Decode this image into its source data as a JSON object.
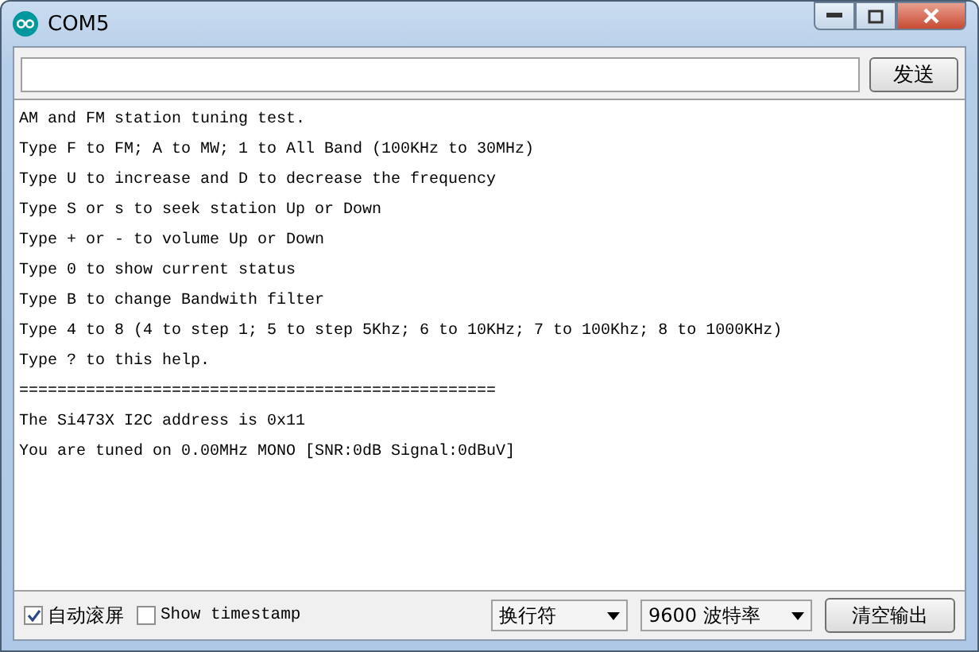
{
  "window": {
    "title": "COM5"
  },
  "send_button": "发送",
  "output_lines": [
    "AM and FM station tuning test.",
    "Type F to FM; A to MW; 1 to All Band (100KHz to 30MHz)",
    "Type U to increase and D to decrease the frequency",
    "Type S or s to seek station Up or Down",
    "Type + or - to volume Up or Down",
    "Type 0 to show current status",
    "Type B to change Bandwith filter",
    "Type 4 to 8 (4 to step 1; 5 to step 5Khz; 6 to 10KHz; 7 to 100Khz; 8 to 1000KHz)",
    "Type ? to this help.",
    "==================================================",
    "The Si473X I2C address is 0x11",
    "You are tuned on 0.00MHz MONO [SNR:0dB Signal:0dBuV]"
  ],
  "checkboxes": [
    {
      "label": "自动滚屏",
      "checked": true
    },
    {
      "label": "Show timestamp",
      "checked": false
    }
  ],
  "line_ending": "换行符",
  "baud_rate": "9600 波特率",
  "clear_button": "清空输出"
}
